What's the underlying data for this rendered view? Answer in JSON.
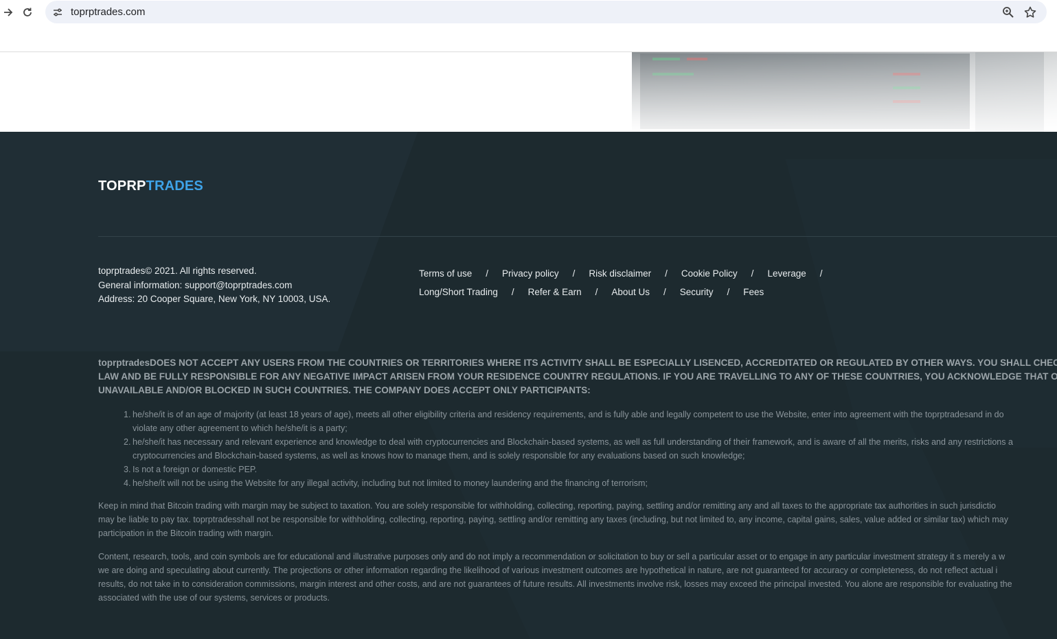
{
  "browser": {
    "url": "toprptrades.com"
  },
  "footer": {
    "logo": {
      "part1": "TOPRP",
      "part2": "TRADES"
    },
    "info": {
      "copyright": "toprptrades© 2021. All rights reserved.",
      "general": "General information: support@toprptrades.com",
      "address": "Address: 20 Cooper Square, New York, NY 10003, USA."
    },
    "links_row1": [
      "Terms of use",
      "Privacy policy",
      "Risk disclaimer",
      "Cookie Policy",
      "Leverage"
    ],
    "links_row2": [
      "Long/Short Trading",
      "Refer & Earn",
      "About Us",
      "Security",
      "Fees"
    ],
    "disclaimer_lines": [
      "toprptradesDOES NOT ACCEPT ANY USERS FROM THE COUNTRIES OR TERRITORIES WHERE ITS ACTIVITY SHALL BE ESPECIALLY LISENCED, ACCREDITATED OR REGULATED BY OTHER WAYS. YOU SHALL CHECK YOUR A",
      "LAW AND BE FULLY RESPONSIBLE FOR ANY NEGATIVE IMPACT ARISEN FROM YOUR RESIDENCE COUNTRY REGULATIONS. IF YOU ARE TRAVELLING TO ANY OF THESE COUNTRIES, YOU ACKNOWLEDGE THAT OUR SE",
      "UNAVAILABLE AND/OR BLOCKED IN SUCH COUNTRIES. THE COMPANY DOES ACCEPT ONLY PARTICIPANTS:"
    ],
    "conditions": [
      {
        "num": "1.",
        "lines": [
          "he/she/it is of an age of majority (at least 18 years of age), meets all other eligibility criteria and residency requirements, and is fully able and legally competent to use the Website, enter into agreement with the toprptradesand in do",
          "violate any other agreement to which he/she/it is a party;"
        ]
      },
      {
        "num": "2.",
        "lines": [
          "he/she/it has necessary and relevant experience and knowledge to deal with cryptocurrencies and Blockchain-based systems, as well as full understanding of their framework, and is aware of all the merits, risks and any restrictions a",
          "cryptocurrencies and Blockchain-based systems, as well as knows how to manage them, and is solely responsible for any evaluations based on such knowledge;"
        ]
      },
      {
        "num": "3.",
        "lines": [
          "Is not a foreign or domestic PEP."
        ]
      },
      {
        "num": "4.",
        "lines": [
          "he/she/it will not be using the Website for any illegal activity, including but not limited to money laundering and the financing of terrorism;"
        ]
      }
    ],
    "tax_paragraph": [
      "Keep in mind that Bitcoin trading with margin may be subject to taxation. You are solely responsible for withholding, collecting, reporting, paying, settling and/or remitting any and all taxes to the appropriate tax authorities in such jurisdictio",
      "may be liable to pay tax. toprptradesshall not be responsible for withholding, collecting, reporting, paying, settling and/or remitting any taxes (including, but not limited to, any income, capital gains, sales, value added or similar tax) which may",
      "participation in the Bitcoin trading with margin."
    ],
    "content_paragraph": [
      "Content, research, tools, and coin symbols are for educational and illustrative purposes only and do not imply a recommendation or solicitation to buy or sell a particular asset or to engage in any particular investment strategy it s merely a w",
      "we are doing and speculating about currently. The projections or other information regarding the likelihood of various investment outcomes are hypothetical in nature, are not guaranteed for accuracy or completeness, do not reflect actual i",
      "results, do not take in to consideration commissions, margin interest and other costs, and are not guarantees of future results. All investments involve risk, losses may exceed the principal invested. You alone are responsible for evaluating the",
      "associated with the use of our systems, services or products."
    ]
  }
}
